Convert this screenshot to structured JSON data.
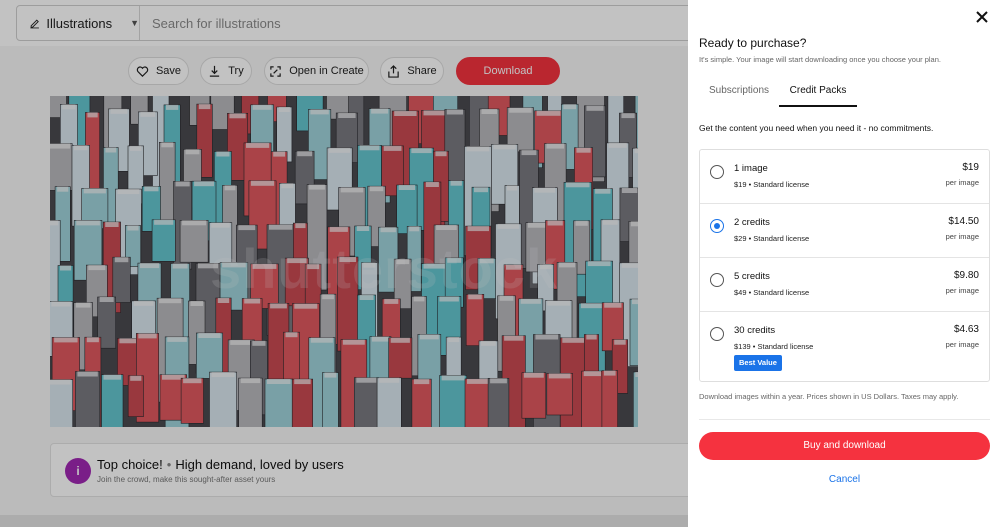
{
  "header": {
    "asset_type": "Illustrations",
    "search_placeholder": "Search for illustrations"
  },
  "toolbar": {
    "save_label": "Save",
    "try_label": "Try",
    "open_create_label": "Open in Create",
    "share_label": "Share",
    "download_label": "Download"
  },
  "promo": {
    "title": "Top choice!",
    "title_suffix": "High demand, loved by users",
    "subtitle": "Join the crowd, make this sought-after asset yours",
    "icon_color": "#a128b3"
  },
  "panel": {
    "title": "Ready to purchase?",
    "subtitle": "It's simple. Your image will start downloading once you choose your plan.",
    "tabs": [
      {
        "label": "Subscriptions",
        "active": false
      },
      {
        "label": "Credit Packs",
        "active": true
      }
    ],
    "intro": "Get the content you need when you need it - no commitments.",
    "options": [
      {
        "name": "1 image",
        "desc": "$19 • Standard license",
        "price": "$19",
        "per": "per image",
        "selected": false
      },
      {
        "name": "2 credits",
        "desc": "$29 • Standard license",
        "price": "$14.50",
        "per": "per image",
        "selected": true
      },
      {
        "name": "5 credits",
        "desc": "$49 • Standard license",
        "price": "$9.80",
        "per": "per image",
        "selected": false
      },
      {
        "name": "30 credits",
        "desc": "$139 • Standard license",
        "price": "$4.63",
        "per": "per image",
        "selected": false,
        "badge": "Best Value"
      }
    ],
    "footnote": "Download images within a year. Prices shown in US Dollars. Taxes may apply.",
    "buy_label": "Buy and download",
    "cancel_label": "Cancel"
  },
  "colors": {
    "brand_red": "#f5323f",
    "accent_blue": "#1a73e8"
  }
}
